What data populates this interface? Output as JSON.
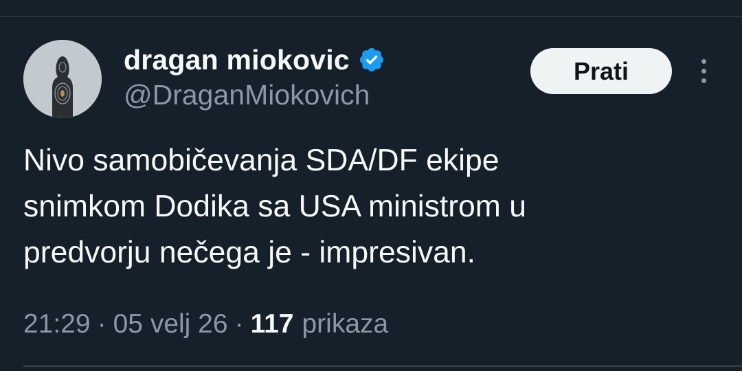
{
  "tweet": {
    "author": {
      "display_name": "dragan miokovic",
      "handle": "@DraganMiokovich",
      "verified": true,
      "avatar_icon": "shooting-target-avatar"
    },
    "follow_label": "Prati",
    "more_icon": "more-vertical-icon",
    "text_lines": [
      "Nivo samobičevanja SDA/DF ekipe",
      "snimkom Dodika sa USA ministrom u",
      "predvorju nečega je - impresivan."
    ],
    "meta": {
      "time": "21:29",
      "date": "05 velj 26",
      "separator": "·",
      "views_count": "117",
      "views_label": "prikaza"
    }
  },
  "colors": {
    "background": "#15202b",
    "primary_text": "#f7f9f9",
    "secondary_text": "#8b98a5",
    "verified_blue": "#1d9bf0",
    "button_bg": "#eff3f4",
    "divider": "#38444d"
  }
}
